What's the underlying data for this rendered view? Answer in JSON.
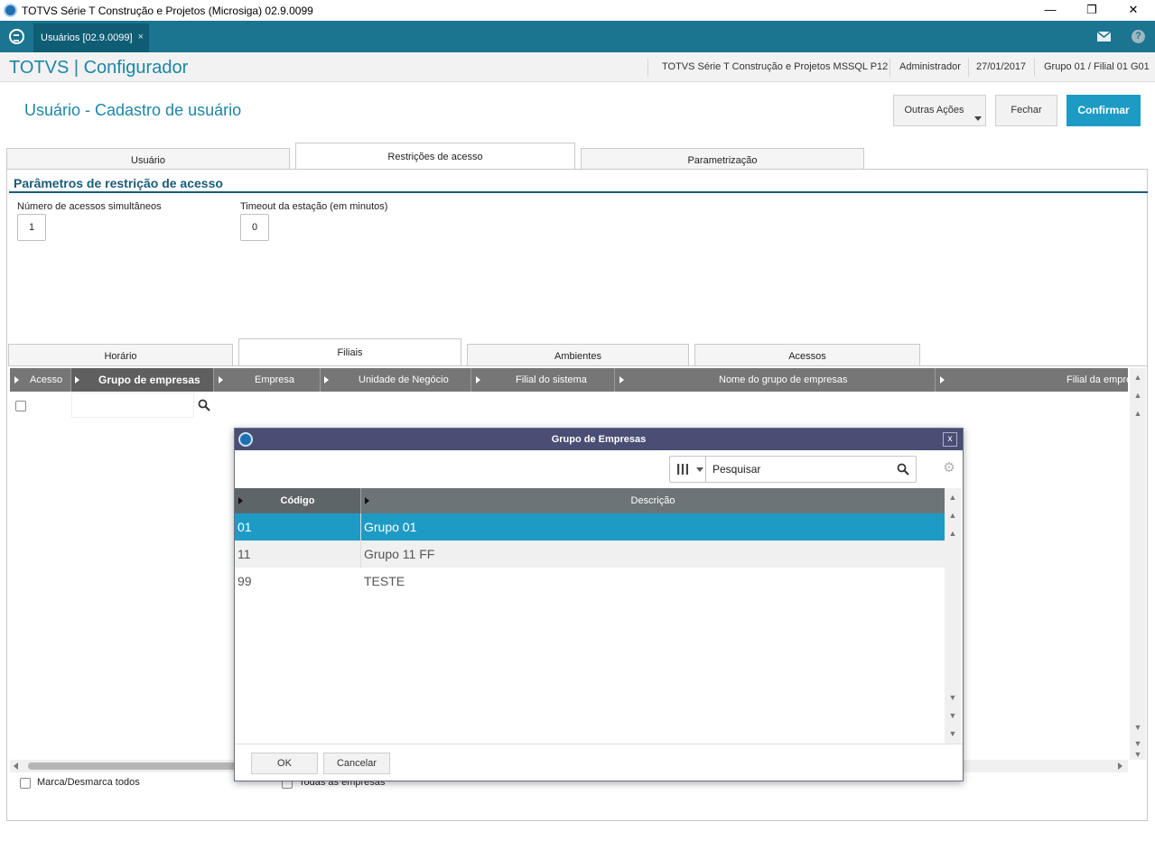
{
  "window": {
    "title": "TOTVS Série T Construção e Projetos (Microsiga) 02.9.0099",
    "minimize": "—",
    "restore": "❐",
    "close": "✕"
  },
  "tabbar": {
    "active_tab": "Usuários [02.9.0099]",
    "close_glyph": "×",
    "help_glyph": "?"
  },
  "header": {
    "brand": "TOTVS | Configurador",
    "environment": "TOTVS Série T Construção e Projetos MSSQL P12",
    "user": "Administrador",
    "date": "27/01/2017",
    "branch": "Grupo 01 / Filial 01 G01"
  },
  "page": {
    "title": "Usuário - Cadastro de usuário",
    "actions": {
      "more": "Outras Ações",
      "close": "Fechar",
      "confirm": "Confirmar"
    }
  },
  "main_tabs": [
    "Usuário",
    "Restrições de acesso",
    "Parametrização"
  ],
  "section": {
    "title": "Parâmetros de restrição de acesso",
    "simultaneous_label": "Número de acessos simultâneos",
    "simultaneous_value": "1",
    "timeout_label": "Timeout da estação (em minutos)",
    "timeout_value": "0"
  },
  "sub_tabs": [
    "Horário",
    "Filiais",
    "Ambientes",
    "Acessos"
  ],
  "grid": {
    "columns": [
      "Acesso",
      "Grupo de empresas",
      "Empresa",
      "Unidade de Negócio",
      "Filial do sistema",
      "Nome do grupo de empresas",
      "Filial da empre"
    ]
  },
  "footer": {
    "toggle_all": "Marca/Desmarca todos",
    "all_companies": "Todas as empresas"
  },
  "dialog": {
    "title": "Grupo de Empresas",
    "close_glyph": "x",
    "search_placeholder": "Pesquisar",
    "columns": [
      "Código",
      "Descrição"
    ],
    "rows": [
      {
        "code": "01",
        "description": "Grupo 01"
      },
      {
        "code": "11",
        "description": "Grupo 11 FF"
      },
      {
        "code": "99",
        "description": "TESTE"
      }
    ],
    "ok": "OK",
    "cancel": "Cancelar"
  },
  "colors": {
    "teal_bar": "#1b7490",
    "brand_blue": "#1d86a8",
    "confirm_button": "#1d9bc5",
    "selected_row": "#1e9bc4",
    "dialog_title": "#4a4e75"
  }
}
